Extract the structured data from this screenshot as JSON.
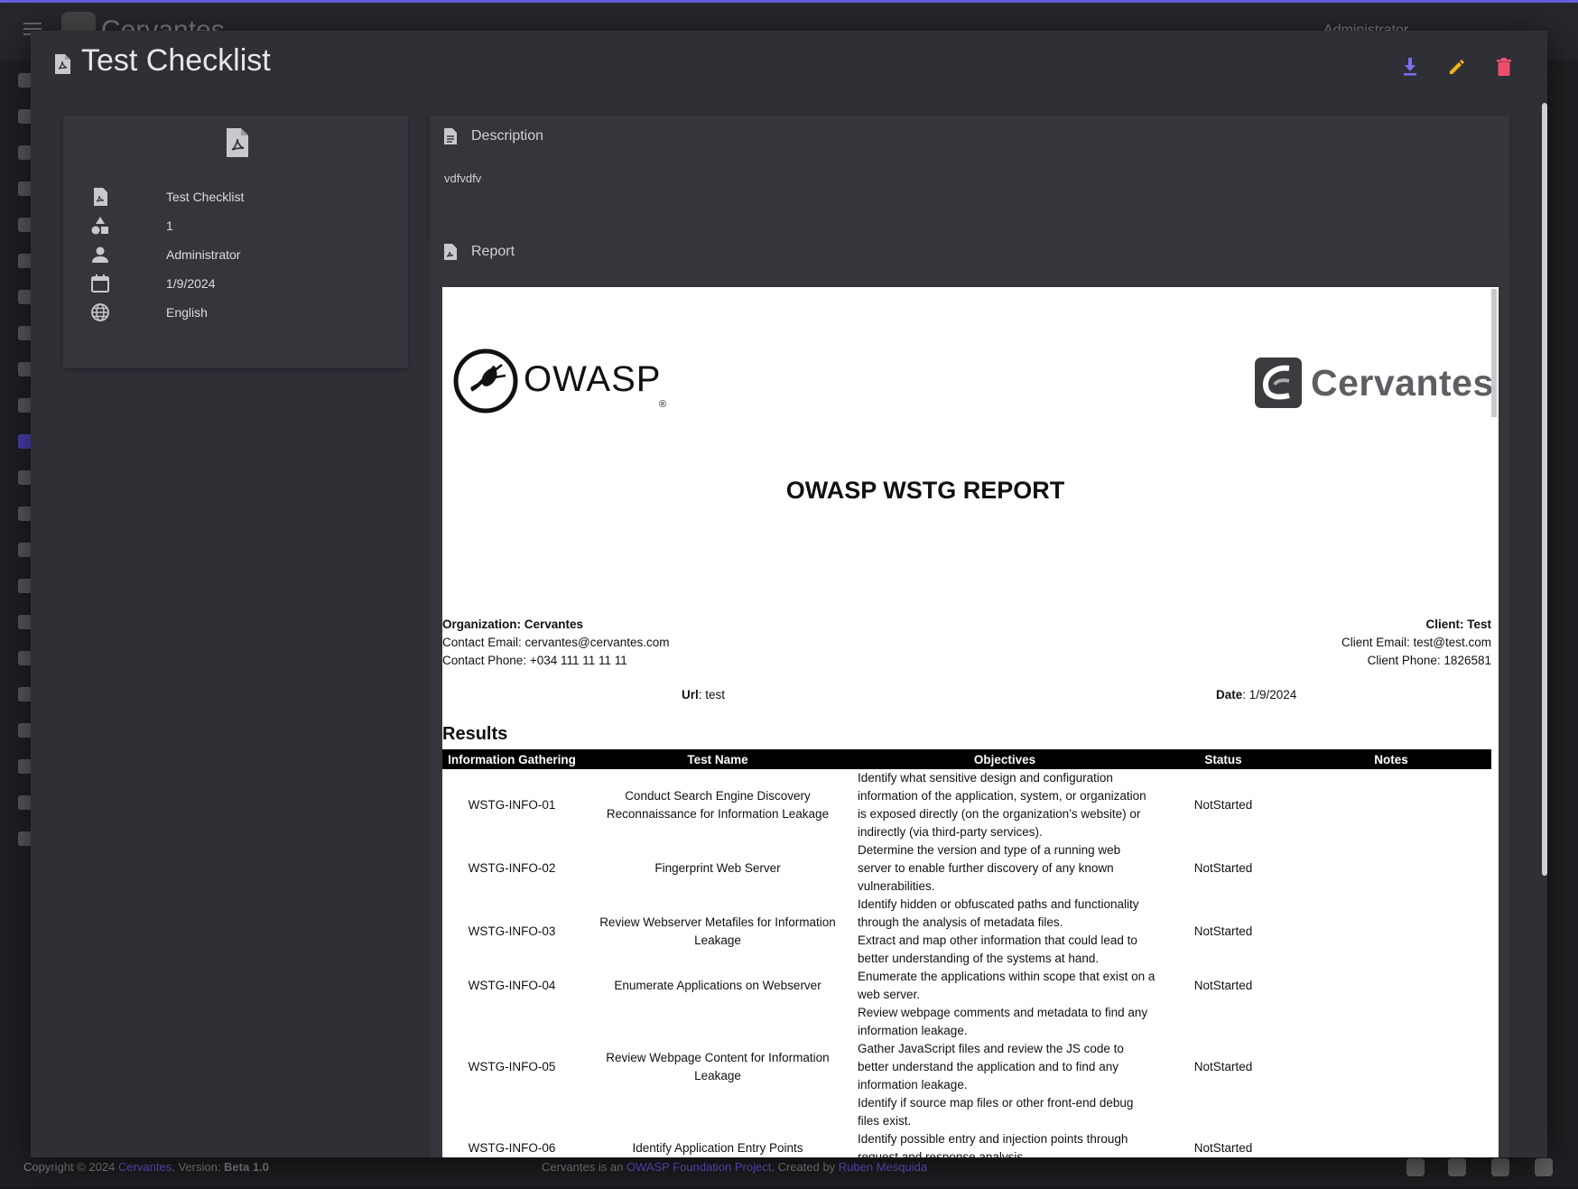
{
  "background": {
    "brand": "Cervantes",
    "user": "Administrator",
    "footer": {
      "copyright_prefix": "Copyright © 2024 ",
      "copyright_link": "Cervantes",
      "version_prefix": ". Version: ",
      "version": "Beta 1.0",
      "center_prefix": "Cervantes is an ",
      "center_link": "OWASP Foundation Project",
      "center_mid": ". Created by ",
      "author": "Ruben Mesquida"
    }
  },
  "dialog": {
    "title": "Test Checklist",
    "actions": {
      "download_icon": "download-icon",
      "edit_icon": "pencil-icon",
      "delete_icon": "trash-icon"
    },
    "colors": {
      "download": "#7b6cf0",
      "edit": "#f1b41d",
      "delete": "#ec4f6e"
    }
  },
  "info": {
    "name": "Test Checklist",
    "count": "1",
    "user": "Administrator",
    "date": "1/9/2024",
    "language": "English"
  },
  "description": {
    "heading": "Description",
    "text": "vdfvdfv"
  },
  "report_section": {
    "heading": "Report"
  },
  "report": {
    "owasp_logo_text": "OWASP",
    "cervantes_logo_text": "Cervantes",
    "title": "OWASP WSTG REPORT",
    "organization_label": "Organization: ",
    "organization": "Cervantes",
    "contact_email": "Contact Email: cervantes@cervantes.com",
    "contact_phone": "Contact Phone: +034 111 11 11 11",
    "client_label": "Client: ",
    "client": "Test",
    "client_email": "Client Email: test@test.com",
    "client_phone": "Client Phone: 1826581",
    "url_label": "Url",
    "url": ": test",
    "date_label": "Date",
    "date": ": 1/9/2024",
    "results_heading": "Results",
    "columns": [
      "Information Gathering",
      "Test Name",
      "Objectives",
      "Status",
      "Notes"
    ],
    "rows": [
      {
        "id": "WSTG-INFO-01",
        "name": "Conduct Search Engine Discovery Reconnaissance for Information Leakage",
        "objectives": [
          "Identify what sensitive design and configuration information of the application, system, or organization is exposed directly (on the organization’s website) or indirectly (via third-party services)."
        ],
        "status": "NotStarted",
        "notes": ""
      },
      {
        "id": "WSTG-INFO-02",
        "name": "Fingerprint Web Server",
        "objectives": [
          "Determine the version and type of a running web server to enable further discovery of any known vulnerabilities."
        ],
        "status": "NotStarted",
        "notes": ""
      },
      {
        "id": "WSTG-INFO-03",
        "name": "Review Webserver Metafiles for Information Leakage",
        "objectives": [
          "Identify hidden or obfuscated paths and functionality through the analysis of metadata files.",
          "Extract and map other information that could lead to better understanding of the systems at hand."
        ],
        "status": "NotStarted",
        "notes": ""
      },
      {
        "id": "WSTG-INFO-04",
        "name": "Enumerate Applications on Webserver",
        "objectives": [
          "Enumerate the applications within scope that exist on a web server."
        ],
        "status": "NotStarted",
        "notes": ""
      },
      {
        "id": "WSTG-INFO-05",
        "name": "Review Webpage Content for Information Leakage",
        "objectives": [
          "Review webpage comments and metadata to find any information leakage.",
          "Gather JavaScript files and review the JS code to better understand the application and to find any information leakage.",
          "Identify if source map files or other front-end debug files exist."
        ],
        "status": "NotStarted",
        "notes": ""
      },
      {
        "id": "WSTG-INFO-06",
        "name": "Identify Application Entry Points",
        "objectives": [
          "Identify possible entry and injection points through request and response analysis."
        ],
        "status": "NotStarted",
        "notes": ""
      }
    ]
  }
}
